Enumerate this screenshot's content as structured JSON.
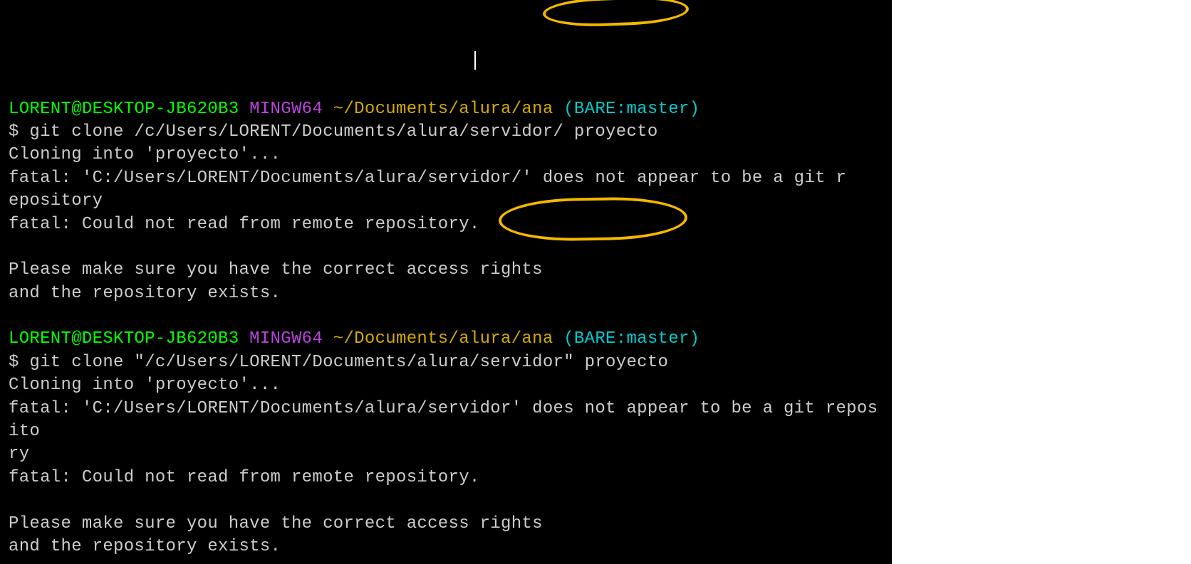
{
  "block1": {
    "user": "LORENT@DESKTOP-JB620B3",
    "env": "MINGW64",
    "path": "~/Documents/alura/ana",
    "branch": "(BARE:master)",
    "cmd_prefix": "$ ",
    "cmd": "git clone /c/Users/LORENT/Documents/alura/servidor/ proyecto",
    "out1": "Cloning into 'proyecto'...",
    "out2": "fatal: 'C:/Users/LORENT/Documents/alura/servidor/' does not appear to be a git r",
    "out3": "epository",
    "out4": "fatal: Could not read from remote repository.",
    "out5": "",
    "out6": "Please make sure you have the correct access rights",
    "out7": "and the repository exists."
  },
  "block2": {
    "user": "LORENT@DESKTOP-JB620B3",
    "env": "MINGW64",
    "path": "~/Documents/alura/ana",
    "branch": "(BARE:master)",
    "cmd_prefix": "$ ",
    "cmd": "git clone \"/c/Users/LORENT/Documents/alura/servidor\" proyecto",
    "out1": "Cloning into 'proyecto'...",
    "out2": "fatal: 'C:/Users/LORENT/Documents/alura/servidor' does not appear to be a git reposito",
    "out3": "ry",
    "out4": "fatal: Could not read from remote repository.",
    "out5": "",
    "out6": "Please make sure you have the correct access rights",
    "out7": "and the repository exists."
  }
}
